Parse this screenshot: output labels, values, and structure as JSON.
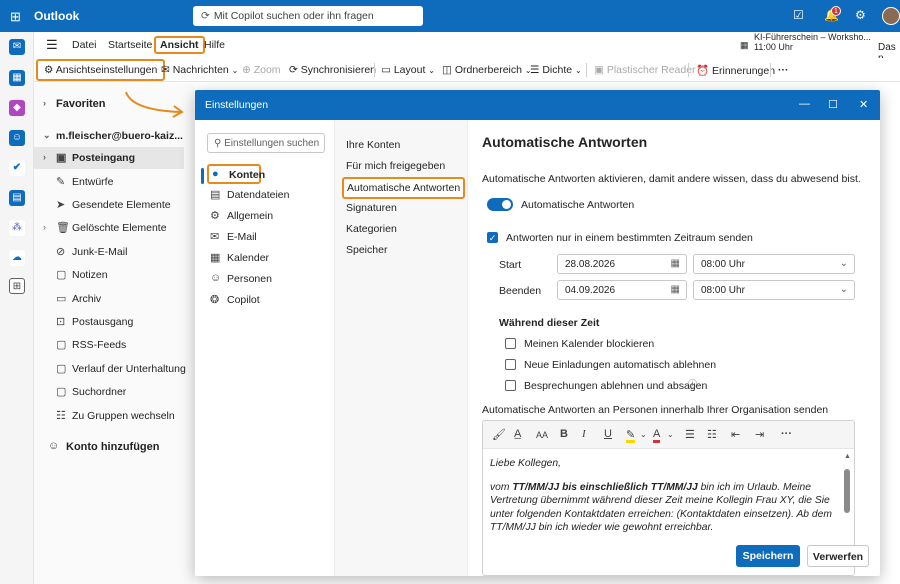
{
  "app": {
    "title": "Outlook",
    "search_placeholder": "Mit Copilot suchen oder ihn fragen",
    "notification_count": "1"
  },
  "menu": {
    "items": [
      "Datei",
      "Startseite",
      "Ansicht",
      "Hilfe"
    ]
  },
  "upnext": {
    "title": "KI-Führerschein – Worksho...",
    "time": "11:00 Uhr",
    "right": "Das n"
  },
  "ribbon": {
    "view_settings": "Ansichtseinstellungen",
    "messages": "Nachrichten",
    "zoom": "Zoom",
    "sync": "Synchronisieren",
    "layout": "Layout",
    "folder_pane": "Ordnerbereich",
    "density": "Dichte",
    "immersive_reader": "Plastischer Reader",
    "reminders": "Erinnerungen",
    "more": "···"
  },
  "folders": {
    "favorites": "Favoriten",
    "account": "m.fleischer@buero-kaiz...",
    "items": [
      "Posteingang",
      "Entwürfe",
      "Gesendete Elemente",
      "Gelöschte Elemente",
      "Junk-E-Mail",
      "Notizen",
      "Archiv",
      "Postausgang",
      "RSS-Feeds",
      "Verlauf der Unterhaltung",
      "Suchordner",
      "Zu Gruppen wechseln"
    ],
    "add_account": "Konto hinzufügen"
  },
  "dialog": {
    "title": "Einstellungen",
    "search_placeholder": "Einstellungen suchen",
    "categories": [
      "Konten",
      "Datendateien",
      "Allgemein",
      "E-Mail",
      "Kalender",
      "Personen",
      "Copilot"
    ],
    "subcategories": [
      "Ihre Konten",
      "Für mich freigegeben",
      "Automatische Antworten",
      "Signaturen",
      "Kategorien",
      "Speicher"
    ],
    "heading": "Automatische Antworten",
    "description": "Automatische Antworten aktivieren, damit andere wissen, dass du abwesend bist.",
    "toggle_label": "Automatische Antworten",
    "timerange_label": "Antworten nur in einem bestimmten Zeitraum senden",
    "start_label": "Start",
    "start_date": "28.08.2026",
    "start_time": "08:00 Uhr",
    "end_label": "Beenden",
    "end_date": "04.09.2026",
    "end_time": "08:00 Uhr",
    "during_label": "Während dieser Zeit",
    "options": [
      "Meinen Kalender blockieren",
      "Neue Einladungen automatisch ablehnen",
      "Besprechungen ablehnen und absagen"
    ],
    "internal_label": "Automatische Antworten an Personen innerhalb Ihrer Organisation senden",
    "message_line1": "Liebe Kollegen,",
    "message_pre": "vom ",
    "message_bold": "TT/MM/JJ bis einschließlich TT/MM/JJ",
    "message_rest": " bin ich im Urlaub. Meine Vertretung übernimmt während dieser Zeit meine Kollegin Frau XY, die Sie unter folgenden Kontaktdaten erreichen: (Kontaktdaten einsetzen). Ab dem TT/MM/JJ bin ich wieder wie gewohnt erreichbar.",
    "save": "Speichern",
    "discard": "Verwerfen"
  }
}
